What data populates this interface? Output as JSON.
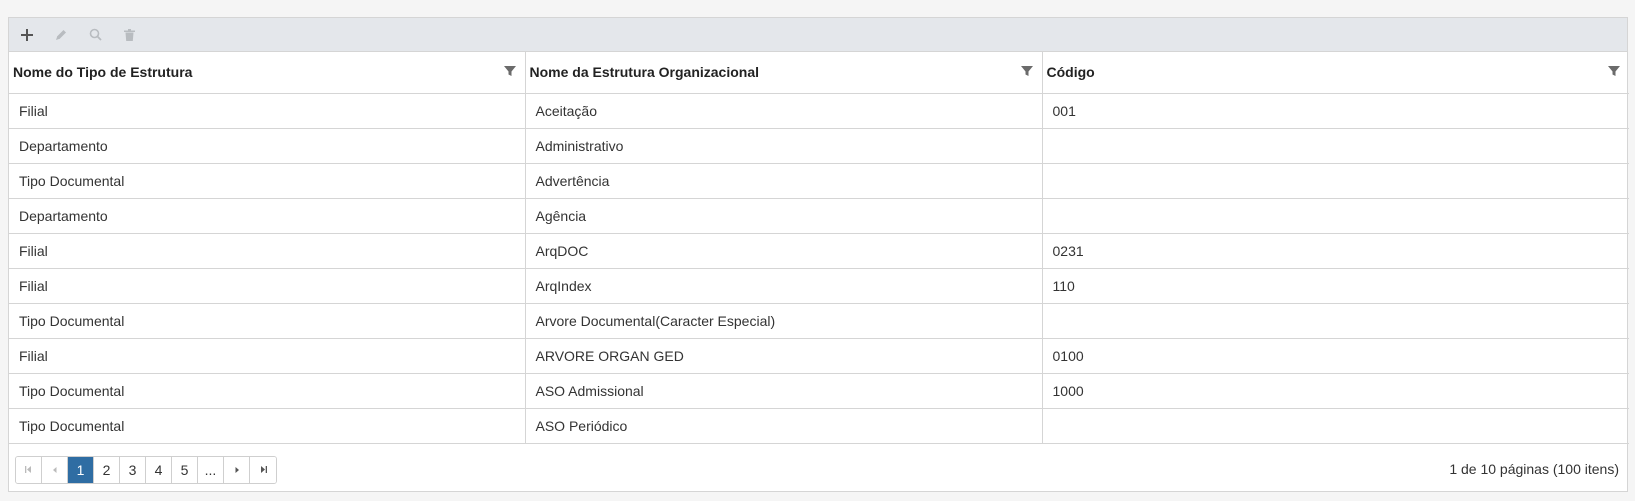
{
  "toolbar": {
    "icons": [
      "plus-icon",
      "pencil-icon",
      "search-icon",
      "trash-icon"
    ]
  },
  "columns": [
    "Nome do Tipo de Estrutura",
    "Nome da Estrutura Organizacional",
    "Código"
  ],
  "rows": [
    [
      "Filial",
      "Aceitação",
      "001"
    ],
    [
      "Departamento",
      "Administrativo",
      ""
    ],
    [
      "Tipo Documental",
      "Advertência",
      ""
    ],
    [
      "Departamento",
      "Agência",
      ""
    ],
    [
      "Filial",
      "ArqDOC",
      "0231"
    ],
    [
      "Filial",
      "ArqIndex",
      "110"
    ],
    [
      "Tipo Documental",
      "Arvore Documental(Caracter Especial)",
      ""
    ],
    [
      "Filial",
      "ARVORE ORGAN GED",
      "0100"
    ],
    [
      "Tipo Documental",
      "ASO Admissional",
      "1000"
    ],
    [
      "Tipo Documental",
      "ASO Periódico",
      ""
    ]
  ],
  "pager": {
    "pages": [
      "1",
      "2",
      "3",
      "4",
      "5",
      "..."
    ],
    "current_page": "1",
    "info": "1 de 10 páginas (100 itens)"
  },
  "colors": {
    "toolbar_bg": "#e4e7eb",
    "active_page": "#2f6da3",
    "border": "#d5d5d5"
  }
}
